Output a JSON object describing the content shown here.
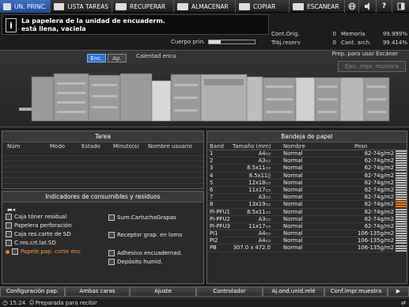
{
  "tabs": [
    {
      "label": "UN. PRINC.",
      "icon": "home-icon",
      "active": true
    },
    {
      "label": "LISTA TAREAS",
      "icon": "list-icon",
      "active": false
    },
    {
      "label": "RECUPERAR",
      "icon": "retrieve-icon",
      "active": false
    },
    {
      "label": "ALMACENAR",
      "icon": "store-icon",
      "active": false
    },
    {
      "label": "COPIAR",
      "icon": "copy-icon",
      "active": false
    },
    {
      "label": "ESCANEAR",
      "icon": "scan-icon",
      "active": false
    }
  ],
  "message": {
    "icon": "info-icon",
    "line1": "La papelera de la unidad de encuaderm.",
    "line2": "está llena, vaciela"
  },
  "body_label": "Cuerpo prin.",
  "body_level": 0.25,
  "counters": [
    {
      "label": "Cont.Orig.",
      "value": "0",
      "label2": "Memoria",
      "value2": "99.999%"
    },
    {
      "label": "Trbj.reserv",
      "value": "0",
      "label2": "Cant. arch.",
      "value2": "99.414%"
    }
  ],
  "toggle": {
    "on_label": "Enc.",
    "off_label": "Ap.",
    "readout": "Calentad encu"
  },
  "status_right": "Prep. para usar Escáner",
  "preview_button": "Ejec. impr. muestra",
  "tarea": {
    "title": "Tarea",
    "headers": [
      "Núm",
      "Modo",
      "Estado",
      "Minuto(s)",
      "Nombre usuario"
    ]
  },
  "consumables": {
    "title": "Indicadores de consumibles y residuos",
    "items": [
      {
        "label": "Caja tóner residual",
        "icon": "toner-box-icon",
        "alert": false
      },
      {
        "label": "Papelera perforación",
        "icon": "punch-bin-icon",
        "alert": false
      },
      {
        "label": "Caja res.corte de SD",
        "icon": "sd-trim-box-icon",
        "alert": false
      },
      {
        "label": "C.res.crt.lat.SD",
        "icon": "sd-side-trim-icon",
        "alert": false
      },
      {
        "label": "Papele pap. corte enc",
        "icon": "binding-trim-bin-icon",
        "alert": true
      },
      {
        "label": "Sum.CartuchoGrapas",
        "icon": "staple-cartridge-icon",
        "alert": false
      },
      {
        "label": "Receptor grap. en lomo",
        "icon": "spine-staple-receiver-icon",
        "alert": false
      },
      {
        "label": "Adhesivo encuadernad.",
        "icon": "adhesive-icon",
        "alert": false
      },
      {
        "label": "Depósito humid.",
        "icon": "humidifier-tank-icon",
        "alert": false
      }
    ]
  },
  "trays": {
    "title": "Bandeja de papel",
    "headers": [
      "Band",
      "Tamaño (mm)",
      "Nombre",
      "Peso"
    ],
    "rows": [
      {
        "band": "1",
        "size": "A4▭",
        "name": "Normal",
        "weight": "62-74g/m2",
        "level": 0.9,
        "alert": false
      },
      {
        "band": "2",
        "size": "A3▭",
        "name": "Normal",
        "weight": "62-74g/m2",
        "level": 0.9,
        "alert": false
      },
      {
        "band": "3",
        "size": "8.5x11▭",
        "name": "Normal",
        "weight": "62-74g/m2",
        "level": 0.9,
        "alert": false
      },
      {
        "band": "4",
        "size": "8.5x11▯",
        "name": "Normal",
        "weight": "62-74g/m2",
        "level": 0.9,
        "alert": false
      },
      {
        "band": "5",
        "size": "12x18▭",
        "name": "Normal",
        "weight": "62-74g/m2",
        "level": 0.9,
        "alert": false
      },
      {
        "band": "6",
        "size": "11x17▭",
        "name": "Normal",
        "weight": "62-74g/m2",
        "level": 0.9,
        "alert": false
      },
      {
        "band": "7",
        "size": "A3▭",
        "name": "Normal",
        "weight": "62-74g/m2",
        "level": 0.9,
        "alert": false
      },
      {
        "band": "8",
        "size": "13x19▭",
        "name": "Normal",
        "weight": "62-74g/m2",
        "level": 0.1,
        "alert": true
      },
      {
        "band": "PI-PFU1",
        "size": "8.5x11▭",
        "name": "Normal",
        "weight": "62-74g/m2",
        "level": 0.9,
        "alert": false
      },
      {
        "band": "PI-PFU2",
        "size": "A3▭",
        "name": "Normal",
        "weight": "62-74g/m2",
        "level": 0.9,
        "alert": false
      },
      {
        "band": "PI-PFU3",
        "size": "11x17▭",
        "name": "Normal",
        "weight": "62-74g/m2",
        "level": 0.9,
        "alert": false
      },
      {
        "band": "PI1",
        "size": "A4▭",
        "name": "Normal",
        "weight": "106-135g/m2",
        "level": 0.9,
        "alert": false
      },
      {
        "band": "PI2",
        "size": "A4▭",
        "name": "Normal",
        "weight": "106-135g/m2",
        "level": 0.9,
        "alert": false
      },
      {
        "band": "PB",
        "size": "307.0 x 472.0",
        "name": "Normal",
        "weight": "106-135g/m2",
        "level": 0.9,
        "alert": false
      }
    ]
  },
  "bottom_buttons": [
    "Configuración pap.",
    "Ambas caras",
    "Ajuste",
    "Controlador",
    "Aj.ond.unid.relé",
    "Conf.impr.muestra"
  ],
  "status": {
    "time": "15:24",
    "text": "Preparada para recibir"
  }
}
